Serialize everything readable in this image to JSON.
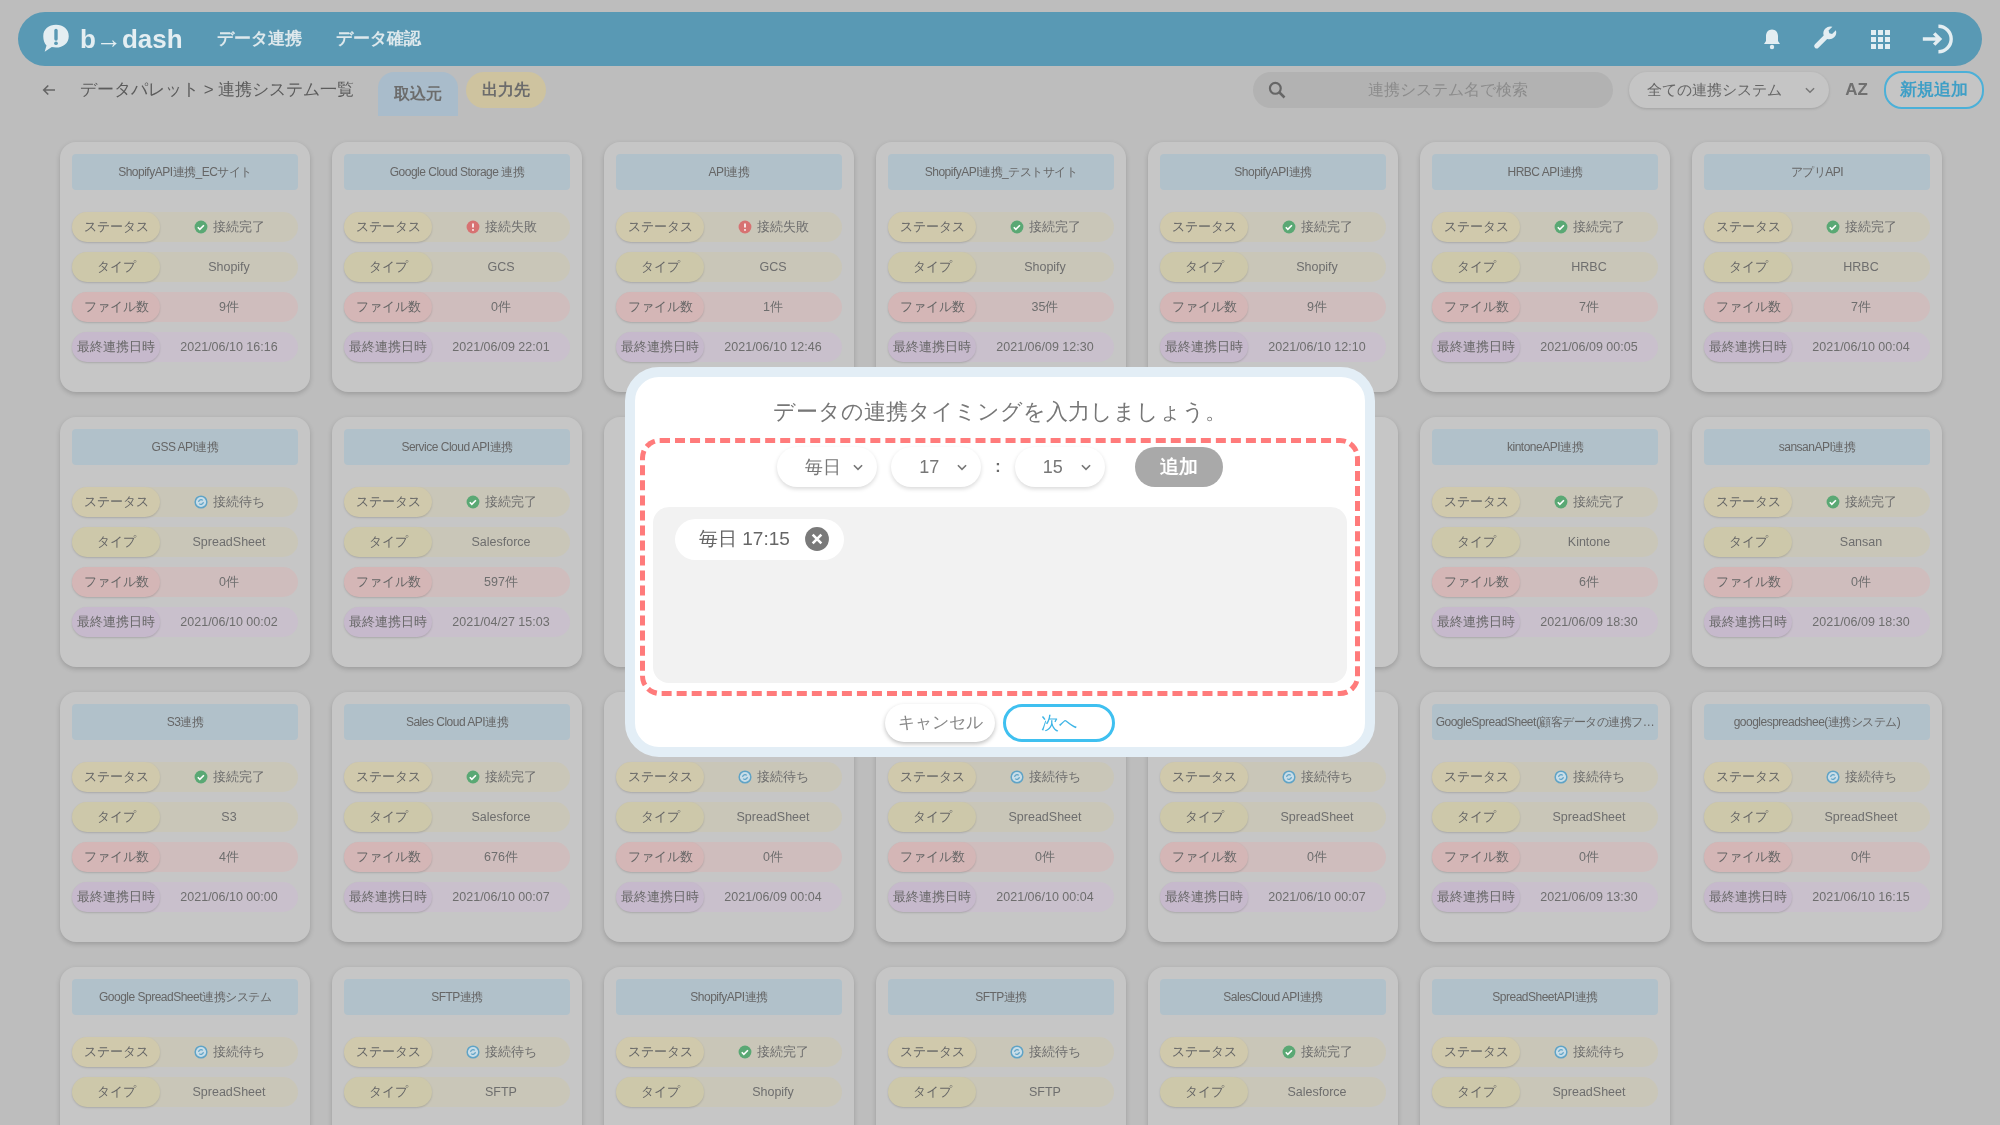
{
  "header": {
    "logo": "b→dash",
    "nav": [
      "データ連携",
      "データ確認"
    ]
  },
  "toolbar": {
    "breadcrumb": "データパレット > 連携システム一覧",
    "tabs": [
      {
        "label": "取込元",
        "selected": true
      },
      {
        "label": "出力先",
        "selected": false
      }
    ],
    "search": {
      "placeholder": "連携システム名で検索"
    },
    "filter": "全ての連携システム",
    "sort": "AZ",
    "new_button": "新規追加"
  },
  "cards": [
    {
      "title": "ShopifyAPI連携_ECサイト",
      "rows": [
        {
          "kind": "status",
          "label": "ステータス",
          "value": "接続完了",
          "icon": {
            "kind": "check",
            "color": "#5aa874"
          }
        },
        {
          "kind": "type",
          "label": "タイプ",
          "value": "Shopify"
        },
        {
          "kind": "files",
          "label": "ファイル数",
          "value": "9件"
        },
        {
          "kind": "date",
          "label": "最終連携日時",
          "value": "2021/06/10 16:16"
        }
      ]
    },
    {
      "title": "Google Cloud Storage 連携",
      "rows": [
        {
          "kind": "status",
          "label": "ステータス",
          "value": "接続失敗",
          "icon": {
            "kind": "alert",
            "color": "#d77272"
          }
        },
        {
          "kind": "type",
          "label": "タイプ",
          "value": "GCS"
        },
        {
          "kind": "files",
          "label": "ファイル数",
          "value": "0件"
        },
        {
          "kind": "date",
          "label": "最終連携日時",
          "value": "2021/06/09 22:01"
        }
      ]
    },
    {
      "title": "API連携",
      "rows": [
        {
          "kind": "status",
          "label": "ステータス",
          "value": "接続失敗",
          "icon": {
            "kind": "alert",
            "color": "#d77272"
          }
        },
        {
          "kind": "type",
          "label": "タイプ",
          "value": "GCS"
        },
        {
          "kind": "files",
          "label": "ファイル数",
          "value": "1件"
        },
        {
          "kind": "date",
          "label": "最終連携日時",
          "value": "2021/06/10 12:46"
        }
      ]
    },
    {
      "title": "ShopifyAPI連携_テストサイト",
      "rows": [
        {
          "kind": "status",
          "label": "ステータス",
          "value": "接続完了",
          "icon": {
            "kind": "check",
            "color": "#5aa874"
          }
        },
        {
          "kind": "type",
          "label": "タイプ",
          "value": "Shopify"
        },
        {
          "kind": "files",
          "label": "ファイル数",
          "value": "35件"
        },
        {
          "kind": "date",
          "label": "最終連携日時",
          "value": "2021/06/09 12:30"
        }
      ]
    },
    {
      "title": "ShopifyAPI連携",
      "rows": [
        {
          "kind": "status",
          "label": "ステータス",
          "value": "接続完了",
          "icon": {
            "kind": "check",
            "color": "#5aa874"
          }
        },
        {
          "kind": "type",
          "label": "タイプ",
          "value": "Shopify"
        },
        {
          "kind": "files",
          "label": "ファイル数",
          "value": "9件"
        },
        {
          "kind": "date",
          "label": "最終連携日時",
          "value": "2021/06/10 12:10"
        }
      ]
    },
    {
      "title": "HRBC API連携",
      "rows": [
        {
          "kind": "status",
          "label": "ステータス",
          "value": "接続完了",
          "icon": {
            "kind": "check",
            "color": "#5aa874"
          }
        },
        {
          "kind": "type",
          "label": "タイプ",
          "value": "HRBC"
        },
        {
          "kind": "files",
          "label": "ファイル数",
          "value": "7件"
        },
        {
          "kind": "date",
          "label": "最終連携日時",
          "value": "2021/06/09 00:05"
        }
      ]
    },
    {
      "title": "アプリAPI",
      "rows": [
        {
          "kind": "status",
          "label": "ステータス",
          "value": "接続完了",
          "icon": {
            "kind": "check",
            "color": "#5aa874"
          }
        },
        {
          "kind": "type",
          "label": "タイプ",
          "value": "HRBC"
        },
        {
          "kind": "files",
          "label": "ファイル数",
          "value": "7件"
        },
        {
          "kind": "date",
          "label": "最終連携日時",
          "value": "2021/06/10 00:04"
        }
      ]
    },
    {
      "title": "GSS API連携",
      "rows": [
        {
          "kind": "status",
          "label": "ステータス",
          "value": "接続待ち",
          "icon": {
            "kind": "sync",
            "color": "#5fa3c6"
          }
        },
        {
          "kind": "type",
          "label": "タイプ",
          "value": "SpreadSheet"
        },
        {
          "kind": "files",
          "label": "ファイル数",
          "value": "0件"
        },
        {
          "kind": "date",
          "label": "最終連携日時",
          "value": "2021/06/10 00:02"
        }
      ]
    },
    {
      "title": "Service Cloud API連携",
      "rows": [
        {
          "kind": "status",
          "label": "ステータス",
          "value": "接続完了",
          "icon": {
            "kind": "check",
            "color": "#5aa874"
          }
        },
        {
          "kind": "type",
          "label": "タイプ",
          "value": "Salesforce"
        },
        {
          "kind": "files",
          "label": "ファイル数",
          "value": "597件"
        },
        {
          "kind": "date",
          "label": "最終連携日時",
          "value": "2021/04/27 15:03"
        }
      ]
    },
    {
      "covered": true
    },
    {
      "covered": true
    },
    {
      "title": "kintoneAPI連携",
      "rows": [
        {
          "kind": "status",
          "label": "ステータス",
          "value": "接続完了",
          "icon": {
            "kind": "check",
            "color": "#5aa874"
          }
        },
        {
          "kind": "type",
          "label": "タイプ",
          "value": "Kintone"
        },
        {
          "kind": "files",
          "label": "ファイル数",
          "value": "6件"
        },
        {
          "kind": "date",
          "label": "最終連携日時",
          "value": "2021/06/09 18:30"
        }
      ]
    },
    {
      "title": "sansanAPI連携",
      "rows": [
        {
          "kind": "status",
          "label": "ステータス",
          "value": "接続完了",
          "icon": {
            "kind": "check",
            "color": "#5aa874"
          }
        },
        {
          "kind": "type",
          "label": "タイプ",
          "value": "Sansan"
        },
        {
          "kind": "files",
          "label": "ファイル数",
          "value": "0件"
        },
        {
          "kind": "date",
          "label": "最終連携日時",
          "value": "2021/06/09 18:30"
        }
      ]
    },
    {
      "title": "S3連携",
      "rows": [
        {
          "kind": "status",
          "label": "ステータス",
          "value": "接続完了",
          "icon": {
            "kind": "check",
            "color": "#5aa874"
          }
        },
        {
          "kind": "type",
          "label": "タイプ",
          "value": "S3"
        },
        {
          "kind": "files",
          "label": "ファイル数",
          "value": "4件"
        },
        {
          "kind": "date",
          "label": "最終連携日時",
          "value": "2021/06/10 00:00"
        }
      ]
    },
    {
      "title": "Sales Cloud API連携",
      "rows": [
        {
          "kind": "status",
          "label": "ステータス",
          "value": "接続完了",
          "icon": {
            "kind": "check",
            "color": "#5aa874"
          }
        },
        {
          "kind": "type",
          "label": "タイプ",
          "value": "Salesforce"
        },
        {
          "kind": "files",
          "label": "ファイル数",
          "value": "676件"
        },
        {
          "kind": "date",
          "label": "最終連携日時",
          "value": "2021/06/10 00:07"
        }
      ]
    },
    {
      "rows": [
        {
          "kind": "status",
          "label": "ステータス",
          "value": "接続待ち",
          "icon": {
            "kind": "sync",
            "color": "#5fa3c6"
          }
        },
        {
          "kind": "type",
          "label": "タイプ",
          "value": "SpreadSheet"
        },
        {
          "kind": "files",
          "label": "ファイル数",
          "value": "0件"
        },
        {
          "kind": "date",
          "label": "最終連携日時",
          "value": "2021/06/09 00:04"
        }
      ]
    },
    {
      "rows": [
        {
          "kind": "status",
          "label": "ステータス",
          "value": "接続待ち",
          "icon": {
            "kind": "sync",
            "color": "#5fa3c6"
          }
        },
        {
          "kind": "type",
          "label": "タイプ",
          "value": "SpreadSheet"
        },
        {
          "kind": "files",
          "label": "ファイル数",
          "value": "0件"
        },
        {
          "kind": "date",
          "label": "最終連携日時",
          "value": "2021/06/10 00:04"
        }
      ]
    },
    {
      "rows": [
        {
          "kind": "status",
          "label": "ステータス",
          "value": "接続待ち",
          "icon": {
            "kind": "sync",
            "color": "#5fa3c6"
          }
        },
        {
          "kind": "type",
          "label": "タイプ",
          "value": "SpreadSheet"
        },
        {
          "kind": "files",
          "label": "ファイル数",
          "value": "0件"
        },
        {
          "kind": "date",
          "label": "最終連携日時",
          "value": "2021/06/10 00:07"
        }
      ]
    },
    {
      "title": "GoogleSpreadSheet(顧客データの連携フ…",
      "rows": [
        {
          "kind": "status",
          "label": "ステータス",
          "value": "接続待ち",
          "icon": {
            "kind": "sync",
            "color": "#5fa3c6"
          }
        },
        {
          "kind": "type",
          "label": "タイプ",
          "value": "SpreadSheet"
        },
        {
          "kind": "files",
          "label": "ファイル数",
          "value": "0件"
        },
        {
          "kind": "date",
          "label": "最終連携日時",
          "value": "2021/06/09 13:30"
        }
      ]
    },
    {
      "title": "googlespreadshee(連携システム)",
      "rows": [
        {
          "kind": "status",
          "label": "ステータス",
          "value": "接続待ち",
          "icon": {
            "kind": "sync",
            "color": "#5fa3c6"
          }
        },
        {
          "kind": "type",
          "label": "タイプ",
          "value": "SpreadSheet"
        },
        {
          "kind": "files",
          "label": "ファイル数",
          "value": "0件"
        },
        {
          "kind": "date",
          "label": "最終連携日時",
          "value": "2021/06/10 16:15"
        }
      ]
    },
    {
      "title": "Google SpreadSheet連携システム",
      "rows": [
        {
          "kind": "status",
          "label": "ステータス",
          "value": "接続待ち",
          "icon": {
            "kind": "sync",
            "color": "#5fa3c6"
          }
        },
        {
          "kind": "type",
          "label": "タイプ",
          "value": "SpreadSheet"
        }
      ]
    },
    {
      "title": "SFTP連携",
      "rows": [
        {
          "kind": "status",
          "label": "ステータス",
          "value": "接続待ち",
          "icon": {
            "kind": "sync",
            "color": "#5fa3c6"
          }
        },
        {
          "kind": "type",
          "label": "タイプ",
          "value": "SFTP"
        }
      ]
    },
    {
      "title": "ShopifyAPI連携",
      "rows": [
        {
          "kind": "status",
          "label": "ステータス",
          "value": "接続完了",
          "icon": {
            "kind": "check",
            "color": "#5aa874"
          }
        },
        {
          "kind": "type",
          "label": "タイプ",
          "value": "Shopify"
        }
      ]
    },
    {
      "title": "SFTP連携",
      "rows": [
        {
          "kind": "status",
          "label": "ステータス",
          "value": "接続待ち",
          "icon": {
            "kind": "sync",
            "color": "#5fa3c6"
          }
        },
        {
          "kind": "type",
          "label": "タイプ",
          "value": "SFTP"
        }
      ]
    },
    {
      "title": "SalesCloud API連携",
      "rows": [
        {
          "kind": "status",
          "label": "ステータス",
          "value": "接続完了",
          "icon": {
            "kind": "check",
            "color": "#5aa874"
          }
        },
        {
          "kind": "type",
          "label": "タイプ",
          "value": "Salesforce"
        }
      ]
    },
    {
      "title": "SpreadSheetAPI連携",
      "rows": [
        {
          "kind": "status",
          "label": "ステータス",
          "value": "接続待ち",
          "icon": {
            "kind": "sync",
            "color": "#5fa3c6"
          }
        },
        {
          "kind": "type",
          "label": "タイプ",
          "value": "SpreadSheet"
        }
      ]
    }
  ],
  "dialog": {
    "title": "データの連携タイミングを入力しましょう。",
    "frequency": "毎日",
    "hour": "17",
    "separator": ":",
    "minute": "15",
    "add_button": {
      "label": "追加",
      "disabled": true
    },
    "entries": [
      {
        "label": "毎日 17:15"
      }
    ],
    "cancel": "キャンセル",
    "next": "次へ"
  }
}
